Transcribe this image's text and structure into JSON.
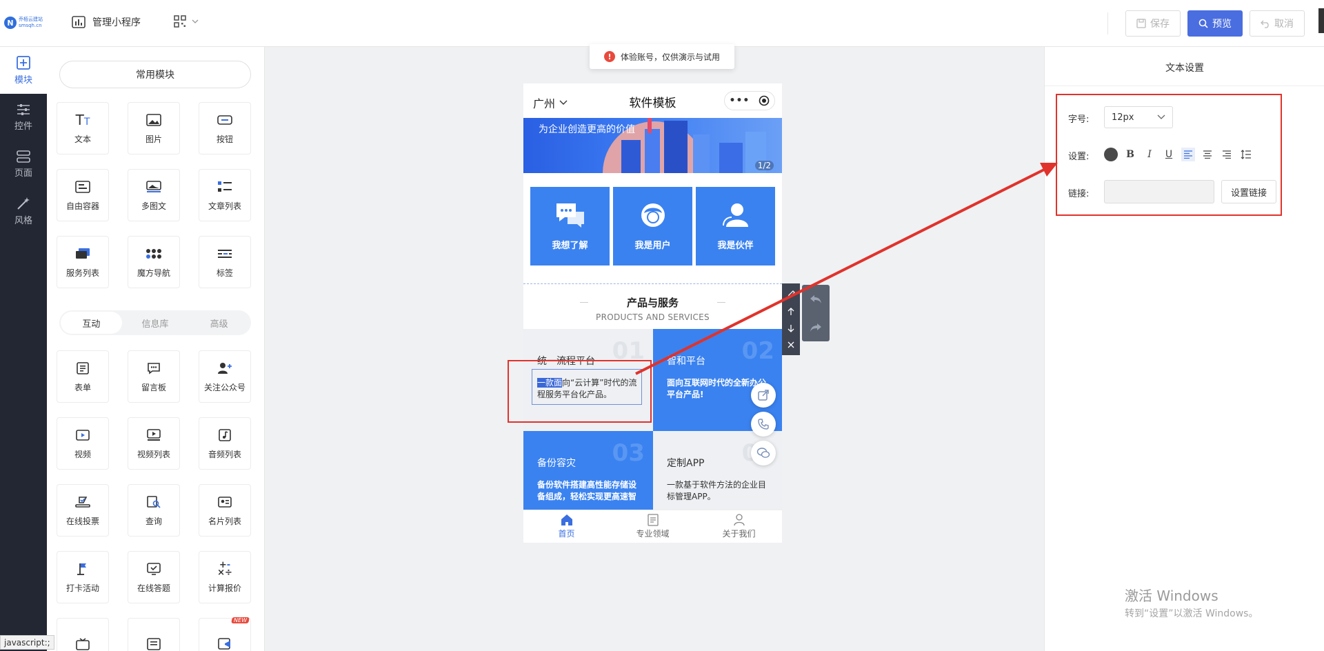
{
  "header": {
    "logo_mark": "N",
    "logo_text": "乔栢云建站",
    "logo_sub": "smsqh.cn",
    "manage_label": "管理小程序",
    "save_label": "保存",
    "preview_label": "预览",
    "cancel_label": "取消"
  },
  "nav": {
    "items": [
      {
        "label": "模块",
        "icon": "plus-square-icon",
        "active": true
      },
      {
        "label": "控件",
        "icon": "sliders-icon",
        "active": false
      },
      {
        "label": "页面",
        "icon": "pages-icon",
        "active": false
      },
      {
        "label": "风格",
        "icon": "magic-wand-icon",
        "active": false
      }
    ]
  },
  "modules": {
    "common_title": "常用模块",
    "common": [
      "文本",
      "图片",
      "按钮",
      "自由容器",
      "多图文",
      "文章列表",
      "服务列表",
      "魔方导航",
      "标签"
    ],
    "tabs": [
      "互动",
      "信息库",
      "高级"
    ],
    "interactive": [
      "表单",
      "留言板",
      "关注公众号",
      "视频",
      "视频列表",
      "音频列表",
      "在线投票",
      "查询",
      "名片列表",
      "打卡活动",
      "在线答题",
      "计算报价"
    ],
    "new_badge": "NEW"
  },
  "status_text": "javascript:;",
  "toast": {
    "icon": "!",
    "text": "体验账号，仅供演示与试用"
  },
  "phone": {
    "city": "广州",
    "title": "软件模板",
    "banner_text": "为企业创造更高的价值",
    "banner_index": "1/2",
    "cards": [
      "我想了解",
      "我是用户",
      "我是伙伴"
    ],
    "section_title": "产品与服务",
    "section_sub": "PRODUCTS AND SERVICES",
    "products": [
      {
        "num": "01",
        "title": "统一流程平台",
        "desc_highlight": "一款面",
        "desc_rest": "向“云计算”时代的流程服务平台化产品。"
      },
      {
        "num": "02",
        "title": "智和平台",
        "desc": "面向互联网时代的全新办公平台产品!"
      },
      {
        "num": "03",
        "title": "备份容灾",
        "desc": "备份软件搭建高性能存储设备组成，轻松实现更高速智"
      },
      {
        "num": "04",
        "title": "定制APP",
        "desc": "一款基于软件方法的企业目标管理APP。"
      }
    ],
    "tabbar": [
      {
        "label": "首页",
        "active": true
      },
      {
        "label": "专业领域",
        "active": false
      },
      {
        "label": "关于我们",
        "active": false
      }
    ]
  },
  "settings": {
    "title": "文本设置",
    "font_size_label": "字号:",
    "font_size_value": "12px",
    "style_label": "设置:",
    "link_label": "链接:",
    "link_value": "",
    "link_button": "设置链接",
    "text_color": "#4a4a4a"
  },
  "watermark": {
    "line1": "激活 Windows",
    "line2": "转到“设置”以激活 Windows。"
  },
  "colors": {
    "accent": "#4a6ee0",
    "card_blue": "#3a82f0",
    "annotation_red": "#e0322b"
  }
}
